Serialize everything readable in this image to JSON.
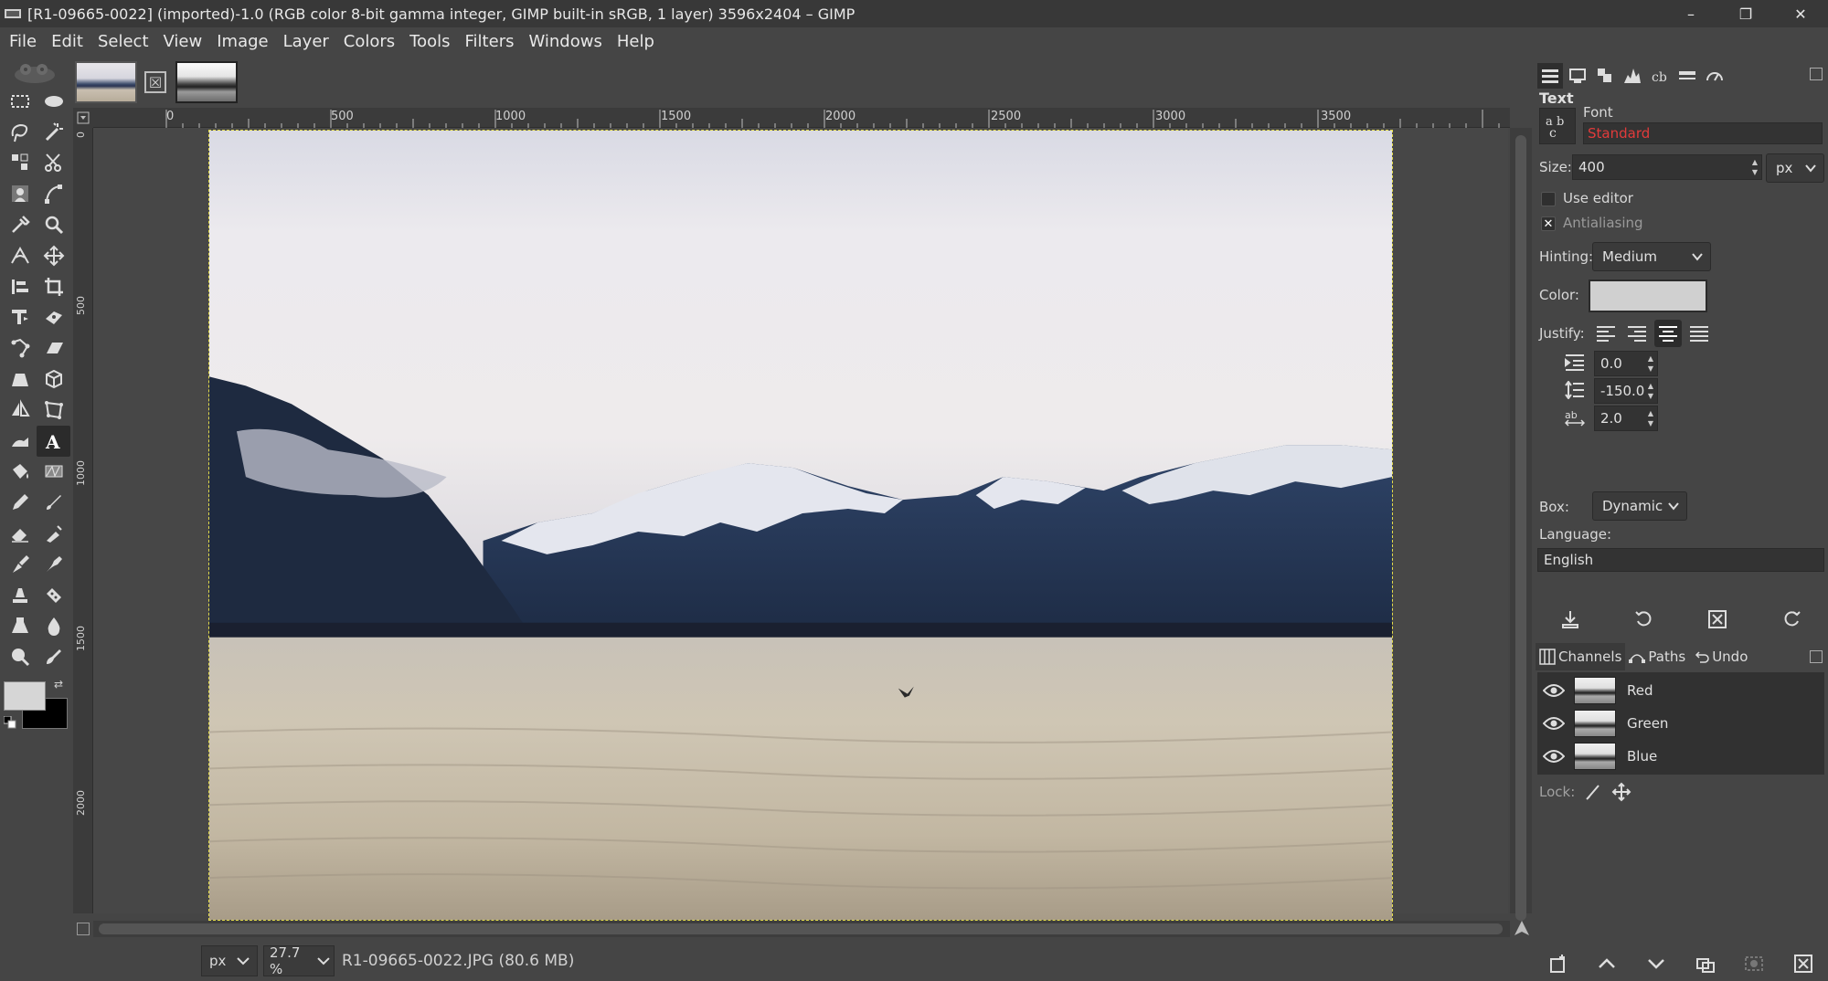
{
  "window": {
    "title": "[R1-09665-0022] (imported)-1.0 (RGB color 8-bit gamma integer, GIMP built-in sRGB, 1 layer) 3596x2404 – GIMP",
    "minimize": "–",
    "maximize": "❐",
    "close": "✕"
  },
  "menubar": {
    "items": [
      "File",
      "Edit",
      "Select",
      "View",
      "Image",
      "Layer",
      "Colors",
      "Tools",
      "Filters",
      "Windows",
      "Help"
    ]
  },
  "toolbox": {
    "tools": [
      "rect-select",
      "ellipse-select",
      "free-select",
      "fuzzy-select",
      "by-color-select",
      "scissors-select",
      "foreground-select",
      "paths",
      "color-picker",
      "zoom",
      "measure",
      "move",
      "align",
      "crop",
      "unified-transform",
      "warp-transform",
      "handle-transform",
      "shear",
      "perspective",
      "3d-transform",
      "flip",
      "cage-transform",
      "smudge",
      "text",
      "bucket-fill",
      "gradient",
      "pencil",
      "paintbrush",
      "eraser",
      "airbrush",
      "ink",
      "mypaint-brush",
      "clone",
      "heal",
      "perspective-clone",
      "blur",
      "dodge-burn",
      "smudge2"
    ],
    "active_tool": "text",
    "foreground_color": "#d6d6d6",
    "background_color": "#000000"
  },
  "image_tabs": {
    "close_label": "☒"
  },
  "rulers": {
    "h_labels": [
      "0",
      "500",
      "1000",
      "1500",
      "2000",
      "2500",
      "3000",
      "3500"
    ],
    "v_labels": [
      "0",
      "500",
      "1000",
      "1500",
      "2000"
    ]
  },
  "statusbar": {
    "unit": "px",
    "zoom": "27.7 %",
    "file_info": "R1-09665-0022.JPG (80.6 MB)"
  },
  "tool_options": {
    "title": "Text",
    "font_label": "Font",
    "font_value": "Standard",
    "size_label": "Size:",
    "size_value": "400",
    "size_unit": "px",
    "use_editor_label": "Use editor",
    "use_editor_checked": false,
    "antialiasing_label": "Antialiasing",
    "antialiasing_checked": true,
    "hinting_label": "Hinting:",
    "hinting_value": "Medium",
    "color_label": "Color:",
    "color_value": "#d0d0d0",
    "justify_label": "Justify:",
    "justify_active": "center",
    "indent_value": "0.0",
    "line_spacing_value": "-150.0",
    "letter_spacing_value": "2.0",
    "box_label": "Box:",
    "box_value": "Dynamic",
    "language_label": "Language:",
    "language_value": "English"
  },
  "channels_dock": {
    "tabs": [
      "Channels",
      "Paths",
      "Undo"
    ],
    "active_tab": "Channels",
    "channels": [
      {
        "name": "Red",
        "visible": true
      },
      {
        "name": "Green",
        "visible": true
      },
      {
        "name": "Blue",
        "visible": true
      }
    ],
    "lock_label": "Lock:"
  }
}
